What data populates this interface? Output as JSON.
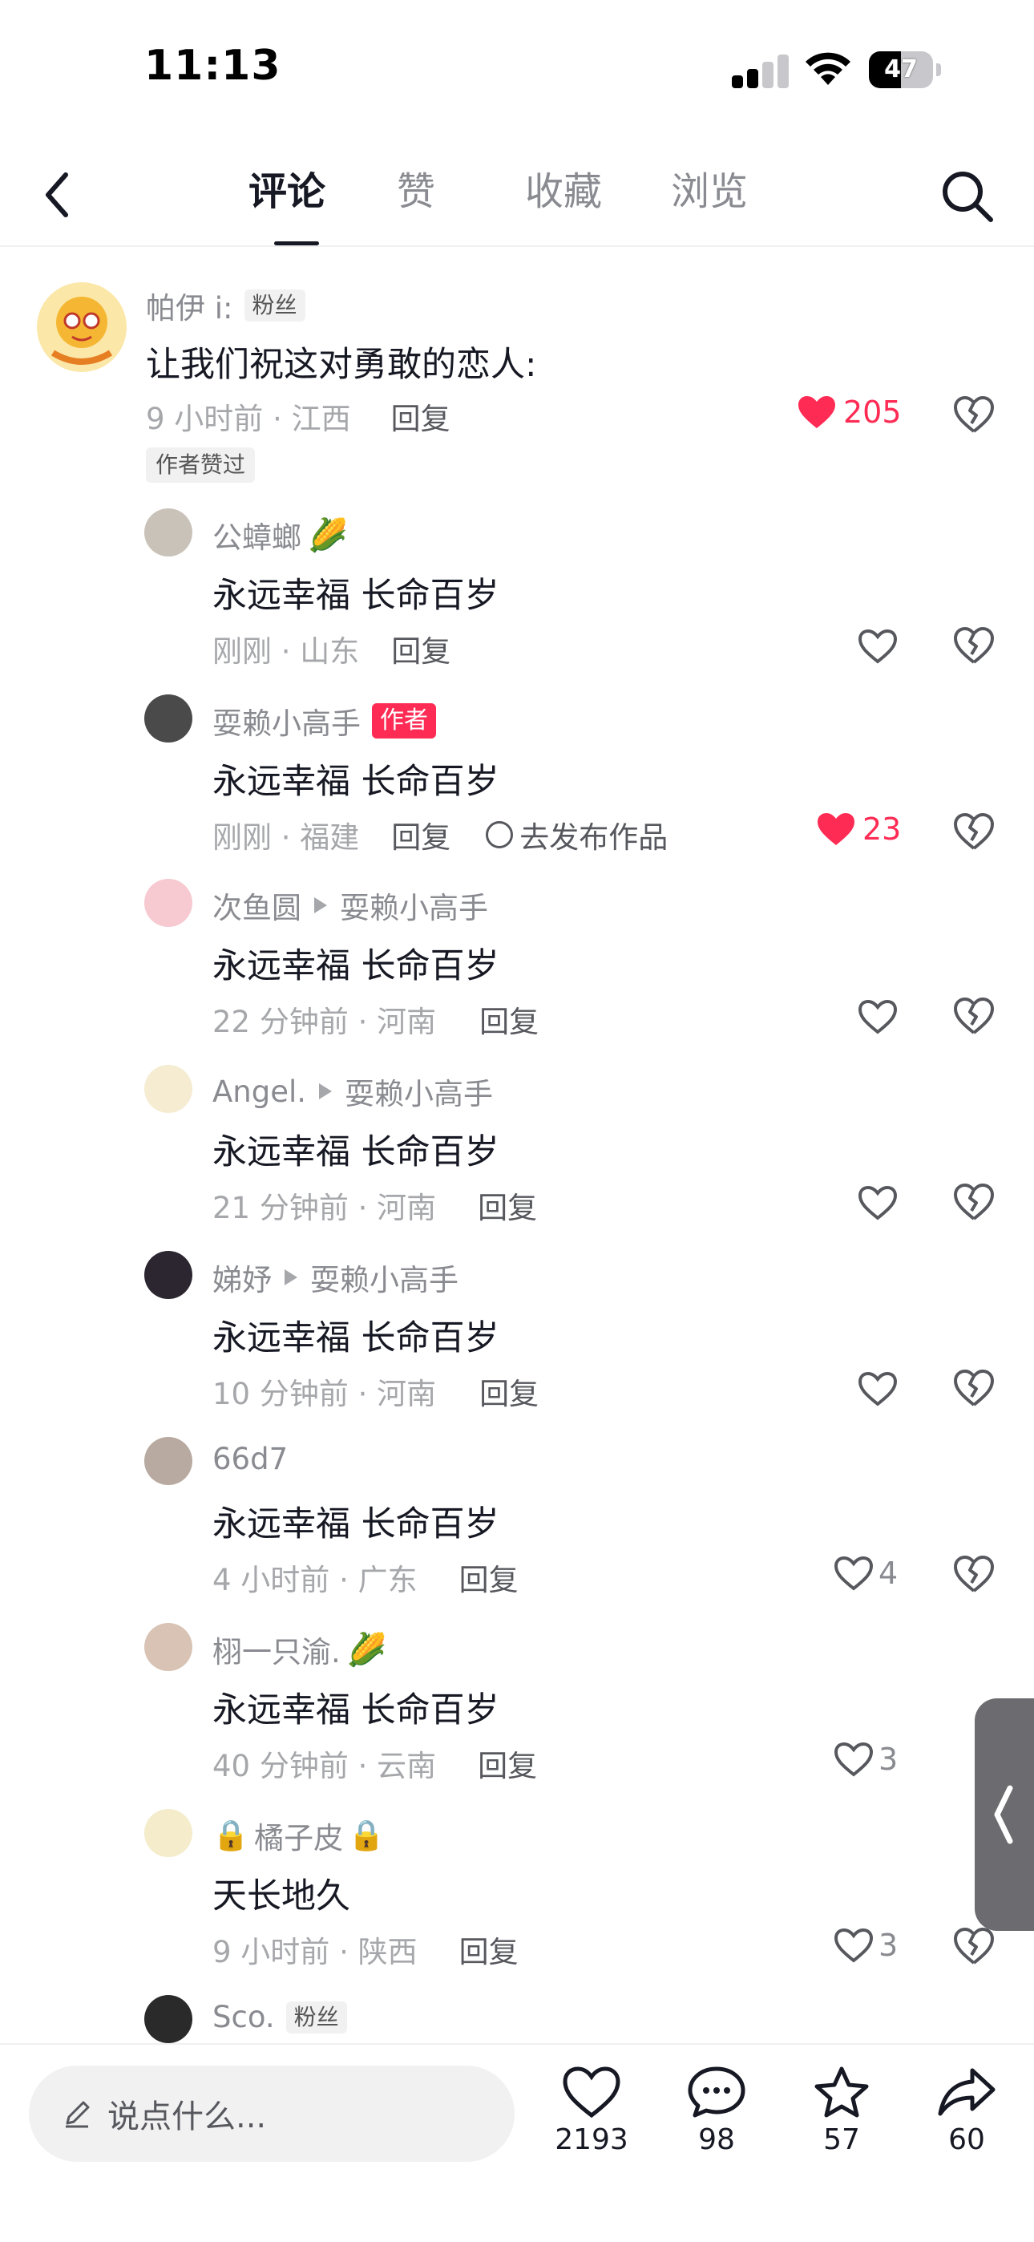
{
  "status_bar": {
    "time": "11:13",
    "battery": "47"
  },
  "header": {
    "tabs": [
      {
        "label": "评论",
        "active": true
      },
      {
        "label": "赞",
        "active": false
      },
      {
        "label": "收藏",
        "active": false
      },
      {
        "label": "浏览",
        "active": false
      }
    ],
    "back_icon": "chevron-left-icon",
    "search_icon": "search-icon"
  },
  "comments": [
    {
      "user": "帕伊 i:",
      "badge": "粉丝",
      "text": "让我们祝这对勇敢的恋人:",
      "meta": "9 小时前 · 江西",
      "reply": "回复",
      "likes": "205",
      "liked": true,
      "author_liked_tag": "作者赞过"
    },
    {
      "user": "公蟑螂",
      "text": "永远幸福 长命百岁",
      "meta": "刚刚 · 山东",
      "reply": "回复",
      "likes": "",
      "liked": false
    },
    {
      "user": "耍赖小高手",
      "badge": "作者",
      "text": "永远幸福 长命百岁",
      "meta": "刚刚 · 福建",
      "reply": "回复",
      "publish": "去发布作品",
      "likes": "23",
      "liked": true
    },
    {
      "user": "次鱼圆",
      "reply_to": "耍赖小高手",
      "text": "永远幸福  长命百岁",
      "meta": "22 分钟前 · 河南",
      "reply": "回复",
      "likes": "",
      "liked": false
    },
    {
      "user": "Angel.",
      "reply_to": "耍赖小高手",
      "text": "永远幸福 长命百岁",
      "meta": "21 分钟前 · 河南",
      "reply": "回复",
      "likes": "",
      "liked": false
    },
    {
      "user": "娣妤",
      "reply_to": "耍赖小高手",
      "text": "永远幸福 长命百岁",
      "meta": "10 分钟前 · 河南",
      "reply": "回复",
      "likes": "",
      "liked": false
    },
    {
      "user": "66d7",
      "text": "永远幸福 长命百岁",
      "meta": "4 小时前 · 广东",
      "reply": "回复",
      "likes": "4",
      "liked": false
    },
    {
      "user": "栩一只渝.",
      "text": "永远幸福 长命百岁",
      "meta": "40 分钟前 · 云南",
      "reply": "回复",
      "likes": "3",
      "liked": false
    },
    {
      "user": "橘子皮",
      "text": "天长地久",
      "meta": "9 小时前 · 陕西",
      "reply": "回复",
      "likes": "3",
      "liked": false
    },
    {
      "user": "Sco.",
      "badge": "粉丝",
      "text": "",
      "meta": "",
      "reply": "",
      "likes": "",
      "liked": false
    }
  ],
  "bottom_bar": {
    "input_placeholder": "说点什么...",
    "likes": "2193",
    "comments": "98",
    "favorites": "57",
    "shares": "60"
  },
  "colors": {
    "accent": "#fe2c55",
    "text": "#161823",
    "muted": "#8a8b91"
  }
}
